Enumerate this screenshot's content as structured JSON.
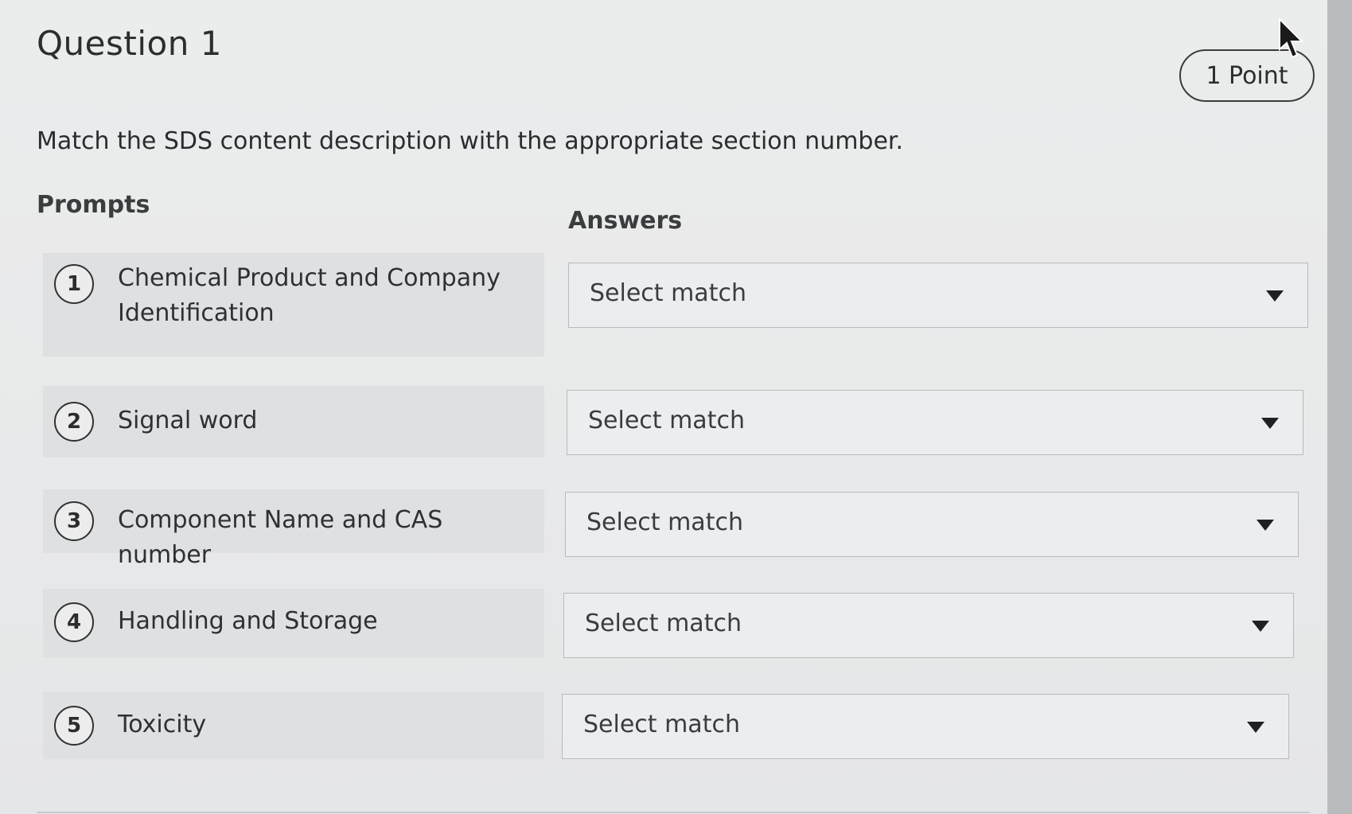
{
  "question": {
    "title": "Question 1",
    "points": "1 Point",
    "instructions": "Match the SDS content description with the appropriate section number."
  },
  "columns": {
    "prompts": "Prompts",
    "answers": "Answers"
  },
  "prompts": [
    {
      "number": "1",
      "text": "Chemical Product and Company Identification"
    },
    {
      "number": "2",
      "text": "Signal word"
    },
    {
      "number": "3",
      "text": "Component Name and CAS number"
    },
    {
      "number": "4",
      "text": "Handling and Storage"
    },
    {
      "number": "5",
      "text": "Toxicity"
    }
  ],
  "answers": [
    {
      "selected": "Select match"
    },
    {
      "selected": "Select match"
    },
    {
      "selected": "Select match"
    },
    {
      "selected": "Select match"
    },
    {
      "selected": "Select match"
    }
  ],
  "icons": {
    "cursor": "mouse-pointer-icon",
    "dropdown": "caret-down-icon"
  }
}
